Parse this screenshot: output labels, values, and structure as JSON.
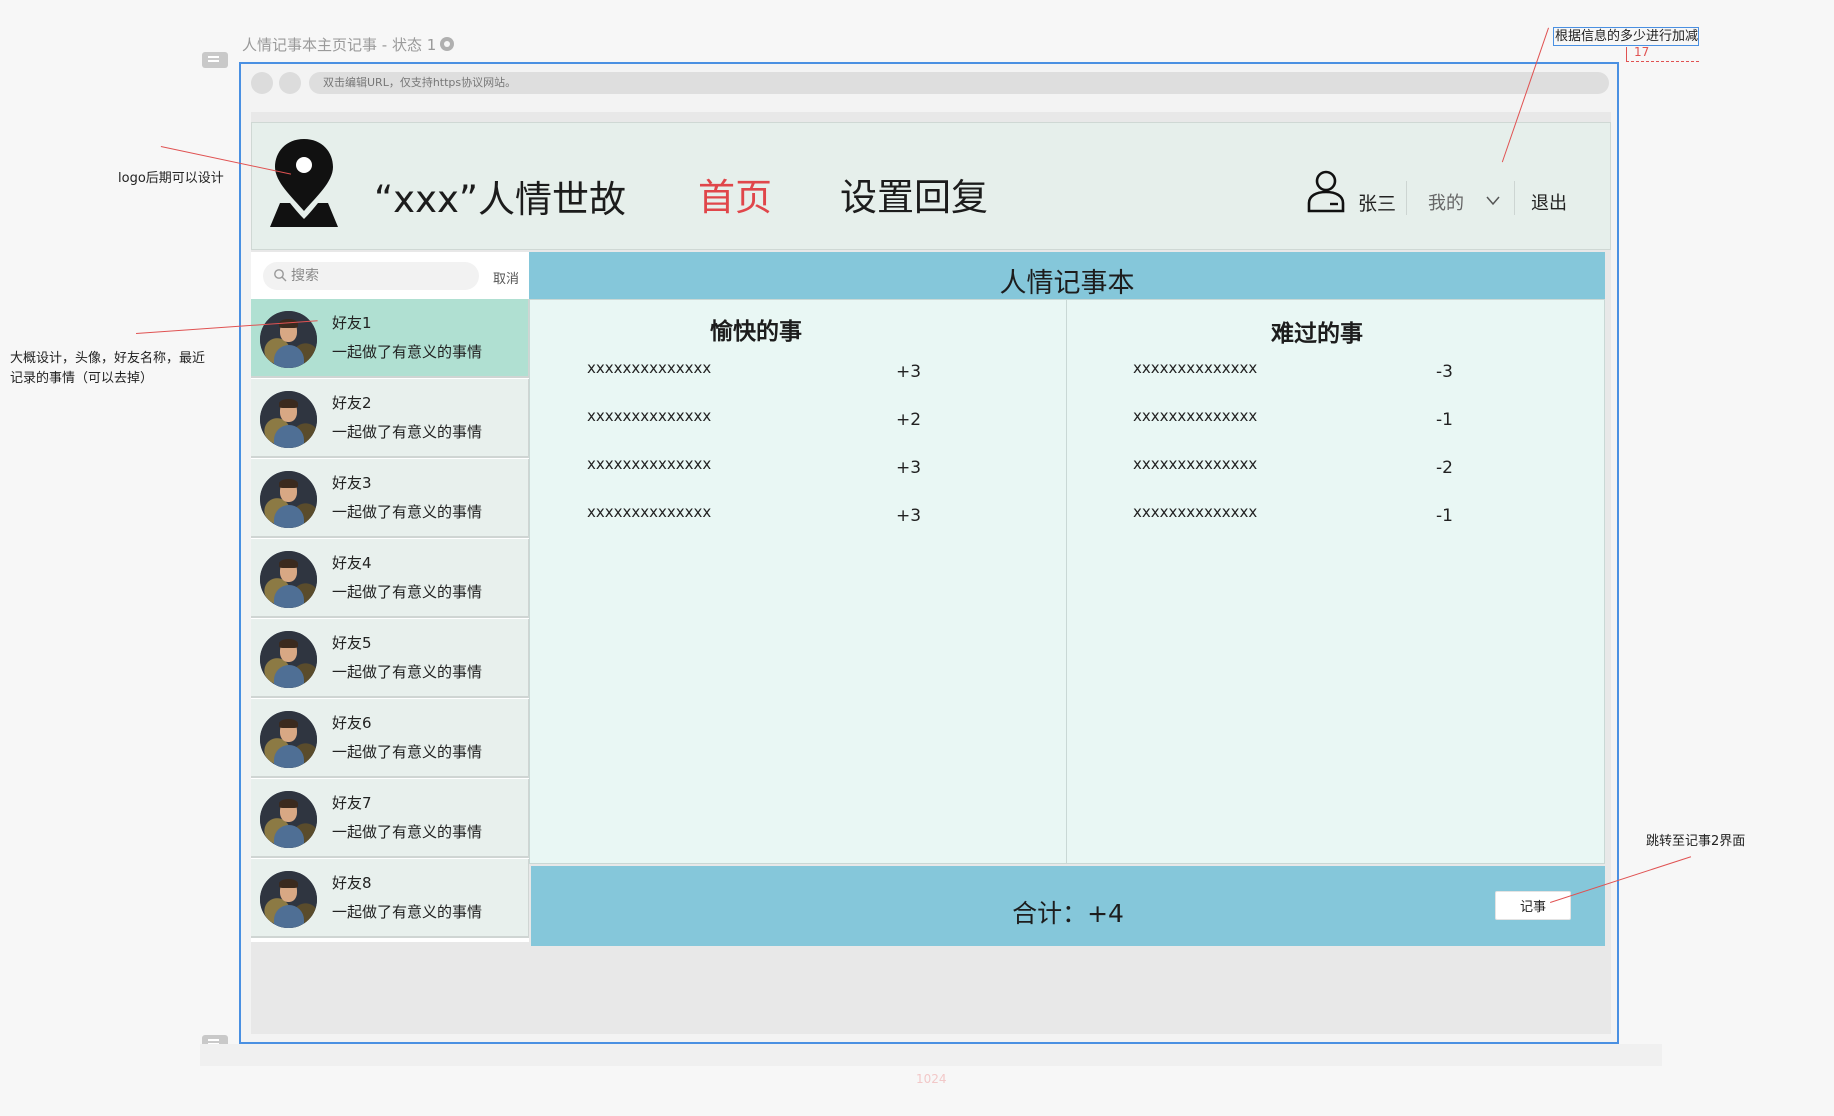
{
  "page_label": "人情记事本主页记事 - 状态 1",
  "browser": {
    "url_placeholder": "双击编辑URL，仅支持https协议网站。"
  },
  "header": {
    "brand": "“xxx”人情世故",
    "nav": [
      {
        "label": "首页",
        "active": true
      },
      {
        "label": "设置回复",
        "active": false
      }
    ],
    "user_name": "张三",
    "my_menu": "我的",
    "logout": "退出"
  },
  "sidebar": {
    "search_placeholder": "搜索",
    "cancel_label": "取消",
    "friends": [
      {
        "name": "好友1",
        "desc": "一起做了有意义的事情",
        "active": true
      },
      {
        "name": "好友2",
        "desc": "一起做了有意义的事情"
      },
      {
        "name": "好友3",
        "desc": "一起做了有意义的事情"
      },
      {
        "name": "好友4",
        "desc": "一起做了有意义的事情"
      },
      {
        "name": "好友5",
        "desc": "一起做了有意义的事情"
      },
      {
        "name": "好友6",
        "desc": "一起做了有意义的事情"
      },
      {
        "name": "好友7",
        "desc": "一起做了有意义的事情"
      },
      {
        "name": "好友8",
        "desc": "一起做了有意义的事情"
      }
    ]
  },
  "main": {
    "title": "人情记事本",
    "happy": {
      "title": "愉快的事",
      "items": [
        {
          "label": "xxxxxxxxxxxxxx",
          "score": "+3"
        },
        {
          "label": "xxxxxxxxxxxxxx",
          "score": "+2"
        },
        {
          "label": "xxxxxxxxxxxxxx",
          "score": "+3"
        },
        {
          "label": "xxxxxxxxxxxxxx",
          "score": "+3"
        }
      ]
    },
    "sad": {
      "title": "难过的事",
      "items": [
        {
          "label": "xxxxxxxxxxxxxx",
          "score": "-3"
        },
        {
          "label": "xxxxxxxxxxxxxx",
          "score": "-1"
        },
        {
          "label": "xxxxxxxxxxxxxx",
          "score": "-2"
        },
        {
          "label": "xxxxxxxxxxxxxx",
          "score": "-1"
        }
      ]
    },
    "total": "合计：+4",
    "record_button": "记事"
  },
  "annotations": {
    "logo_note": "logo后期可以设计",
    "list_note_line1": "大概设计，头像，好友名称，最近",
    "list_note_line2": "记录的事情（可以去掉）",
    "top_note": "根据信息的多少进行加减",
    "top_note_value": "17",
    "jump_note": "跳转至记事2界面",
    "ruler_value": "1024"
  },
  "colors": {
    "accent_red": "#e0464a",
    "title_bar_blue": "#85c7da",
    "active_friend": "#b0e0d2",
    "frame_blue": "#4a90e2"
  }
}
